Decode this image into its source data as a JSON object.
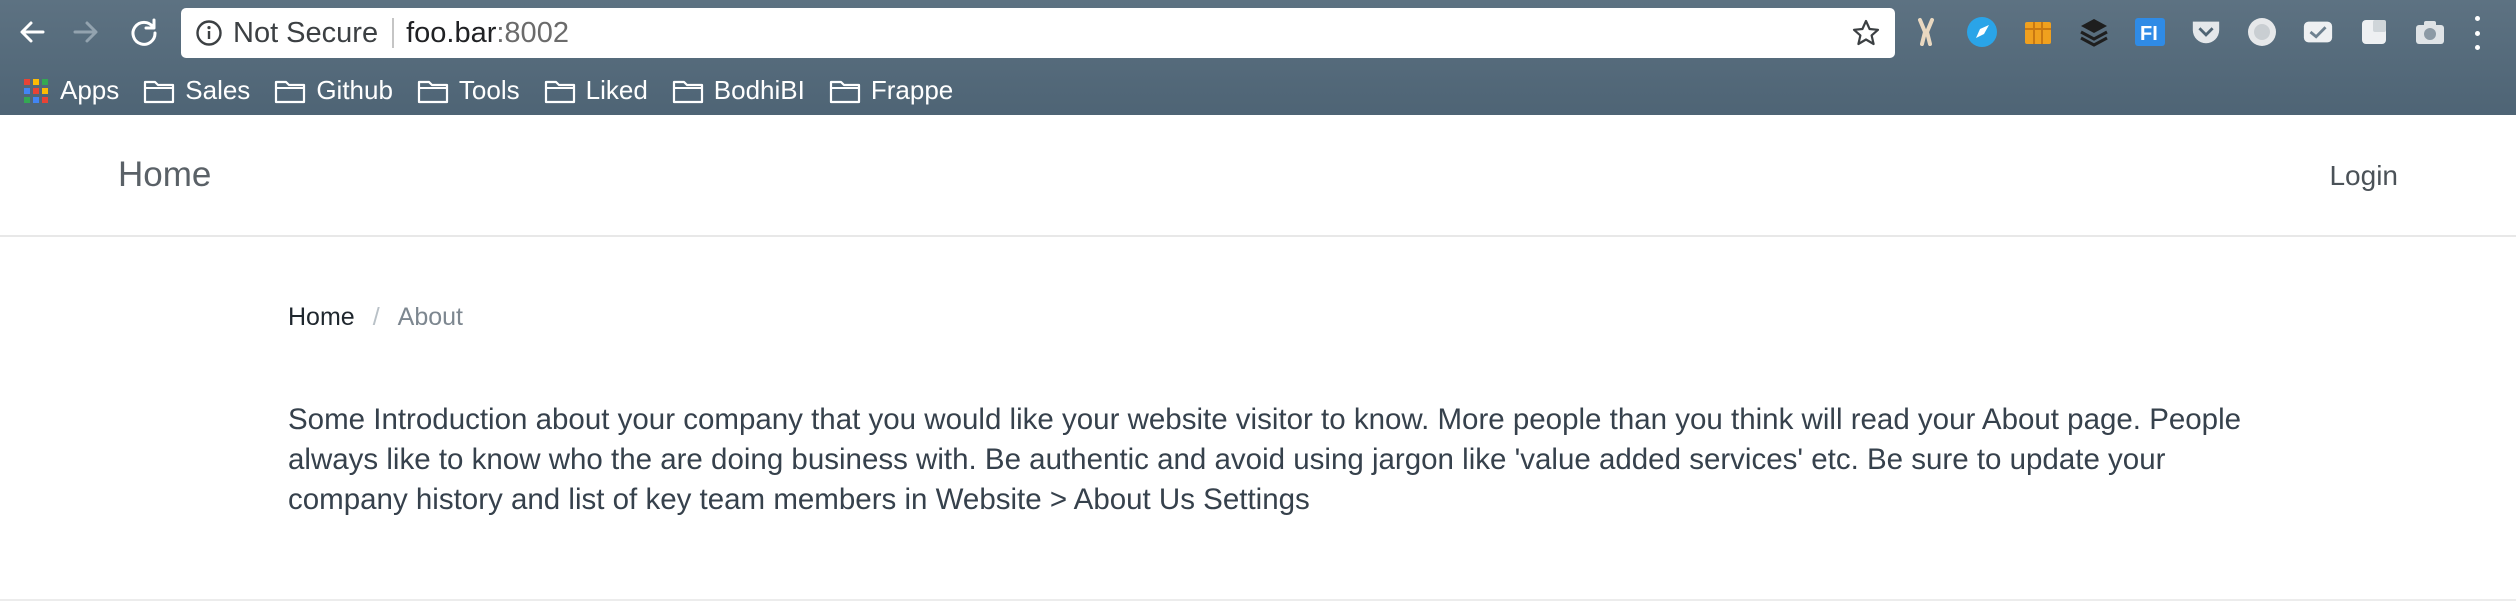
{
  "browser": {
    "security_label": "Not Secure",
    "url_host": "foo.bar",
    "url_port": ":8002",
    "extensions": [
      "tools-icon",
      "compass-icon",
      "box-icon",
      "layers-icon",
      "fi-icon",
      "pocket-icon",
      "circle-icon",
      "check-icon",
      "square-icon",
      "camera-icon"
    ]
  },
  "bookmarks": [
    {
      "label": "Apps",
      "icon": "apps-grid-icon"
    },
    {
      "label": "Sales",
      "icon": "folder-icon"
    },
    {
      "label": "Github",
      "icon": "folder-icon"
    },
    {
      "label": "Tools",
      "icon": "folder-icon"
    },
    {
      "label": "Liked",
      "icon": "folder-icon"
    },
    {
      "label": "BodhiBI",
      "icon": "folder-icon"
    },
    {
      "label": "Frappe",
      "icon": "folder-icon"
    }
  ],
  "navbar": {
    "brand": "Home",
    "login": "Login"
  },
  "breadcrumb": {
    "home": "Home",
    "separator": "/",
    "current": "About"
  },
  "content": {
    "intro_line1": "Some Introduction about your company that you would like your website visitor to know. More people than you think will read your About page. People",
    "intro_line2": "always like to know who the are doing business with. Be authentic and avoid using jargon like 'value added services' etc. Be sure to update your",
    "intro_line3": "company history and list of key team members in Website > About Us Settings"
  },
  "colors": {
    "chrome": "#55697a",
    "text_dark": "#36414c",
    "breadcrumb_muted": "#7d8790"
  }
}
